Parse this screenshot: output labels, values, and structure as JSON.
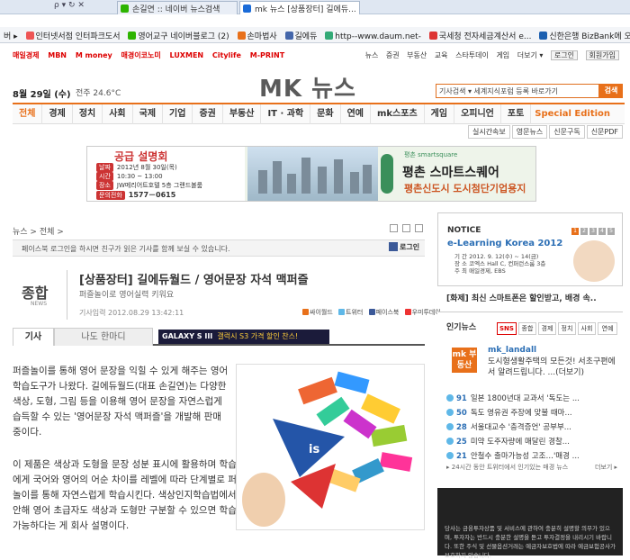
{
  "browser": {
    "nav_glyphs": "ρ ▾ ↻ ✕",
    "tabs": [
      {
        "label": "손길연 :: 네이버 뉴스검색"
      },
      {
        "label": "mk 뉴스 [상품장터] 길에듀..."
      }
    ],
    "favorites": [
      "버 ▸",
      "인터넷서점 인터파크도서",
      "영어교구 네이버블로그 (2)",
      "손마법사",
      "길에듀",
      "http--www.daum.net-",
      "국세청 전자세금계산서 e...",
      "신한은행 BizBank에 오신 ..."
    ]
  },
  "site": {
    "pubs": [
      "매일경제",
      "MBN",
      "M money",
      "매경이코노미",
      "LUXMEN",
      "Citylife",
      "M-PRINT"
    ],
    "util_links": [
      "뉴스",
      "증권",
      "부동산",
      "교육",
      "스타투데이",
      "게임",
      "더보기 ▾"
    ],
    "util_buttons": [
      "로그인",
      "회원가입"
    ],
    "date": "8월 29일 (수)",
    "weather": "전주 24.6°C",
    "logo": "MK 뉴스",
    "search_placeholder": "기사검색 ▾ 세계지식포럼 등록 바로가기",
    "search_button": "검색",
    "gnb": [
      "전체",
      "경제",
      "정치",
      "사회",
      "국제",
      "기업",
      "증권",
      "부동산",
      "IT · 과학",
      "문화",
      "연예",
      "mk스포츠",
      "게임",
      "오피니언",
      "포토",
      "Special Edition"
    ],
    "subnav": [
      "실시간속보",
      "영문뉴스",
      "신문구독",
      "신문PDF"
    ]
  },
  "ad": {
    "title": "공급 설명회",
    "rows": [
      {
        "k": "날짜",
        "v": "2012년 8월 30일(목)"
      },
      {
        "k": "시간",
        "v": "10:30 ~ 13:00"
      },
      {
        "k": "장소",
        "v": "JW메리어트호텔 5층 그랜드볼룸"
      },
      {
        "k": "문의전화",
        "v": "1577－0615"
      }
    ],
    "brand_small": "평촌 smartsquare",
    "headline": "평촌 스마트스퀘어",
    "sub": "평촌신도시 도시첨단기업용지"
  },
  "article": {
    "breadcrumb": "뉴스 > 전체 >",
    "fb_notice": "페이스북 로그인을 하시면 친구가 읽은 기사를 함께 보실 수 있습니다.",
    "fb_login": "로그인",
    "category": "종합",
    "category_en": "NEWS",
    "title": "[상품장터] 길에듀월드 / 영어문장 자석 맥퍼즐",
    "subtitle": "퍼즐놀이로 영어실력 키워요",
    "byline": "기사입력 2012.08.29 13:42:11",
    "share": [
      "싸이월드",
      "트위터",
      "페이스북",
      "우미투데이"
    ],
    "tabs": [
      "기사",
      "나도 한마디"
    ],
    "promo_banner": {
      "brand": "GALAXY S III",
      "text": "갤럭시 S3 가격 할인 찬스!"
    },
    "para1": "퍼즐놀이를 통해 영어 문장을 익힐 수 있게 해주는 영어 학습도구가 나왔다. 길에듀월드(대표 손길연)는 다양한 색상, 도형, 그림 등을 이용해 영어 문장을 자연스럽게 습득할 수 있는 '영어문장 자석 맥퍼즐'을 개발해 판매 중이다.",
    "para2": "이 제품은 색상과 도형을 문장 성분 표시에 활용하며 학습자에게 국어와 영어의 어순 차이를 레벨에 따라 단계별로 퍼즐놀이를 통해 자연스럽게 학습시킨다. 색상인지학습법에서 착안해 영어 초급자도 색상과 도형만 구분할 수 있으면 학습이 가능하다는 게 회사 설명이다.",
    "image_caption_word": "is"
  },
  "sidebar": {
    "notice_title": "NOTICE",
    "notice_dots": [
      "1",
      "2",
      "3",
      "4",
      "5"
    ],
    "elk_title": "e-Learning Korea 2012",
    "elk_info": [
      "기 간  2012. 9. 12(수) ~ 14(금)",
      "장 소  코엑스 Hall C, 컨퍼런스룸 3층",
      "주 최  매일경제, EBS"
    ],
    "promo": "[화제] 최신 스마트폰은 할인받고, 배경 속..",
    "hot_title": "인기뉴스",
    "hot_tabs": [
      "SNS",
      "종합",
      "경제",
      "정치",
      "사회",
      "연예"
    ],
    "mk_logo": "mk 부동산",
    "twitter_name": "mk_landall",
    "twitter_text": "도시형생활주택의 모든것! 서초구편에서 알려드립니다. ...(더보기)",
    "tweets": [
      {
        "n": "91",
        "t": "일본 1800년대 교과서 '독도는 ..."
      },
      {
        "n": "50",
        "t": "독도 영유권 주장에 맞불 때마..."
      },
      {
        "n": "28",
        "t": "서울대교수 '충격증언' 공부부..."
      },
      {
        "n": "25",
        "t": "미약 도주자량에 매달린 경찰..."
      },
      {
        "n": "21",
        "t": "안철수 출마가능성 고조…'매경 ..."
      }
    ],
    "tw_foot": "▸ 24시간 동안 트위터에서 인기있는 매경 뉴스",
    "tw_more": "더보기 ▸",
    "dark_text": "당사는 금융투자상품 및 서비스에 관하여 충분히 설명할 의무가 있으며, 투자자는 반드시 충분한 설명을 듣고 투자결정을 내리시기 바랍니다. 또한 주식 및 선물옵션거래는 예금자보호법에 따라 예금보험공사가 보호하지 않습니다."
  },
  "colors": {
    "accent": "#e8701a",
    "link": "#2c6fb5",
    "alert": "#cc0000"
  }
}
